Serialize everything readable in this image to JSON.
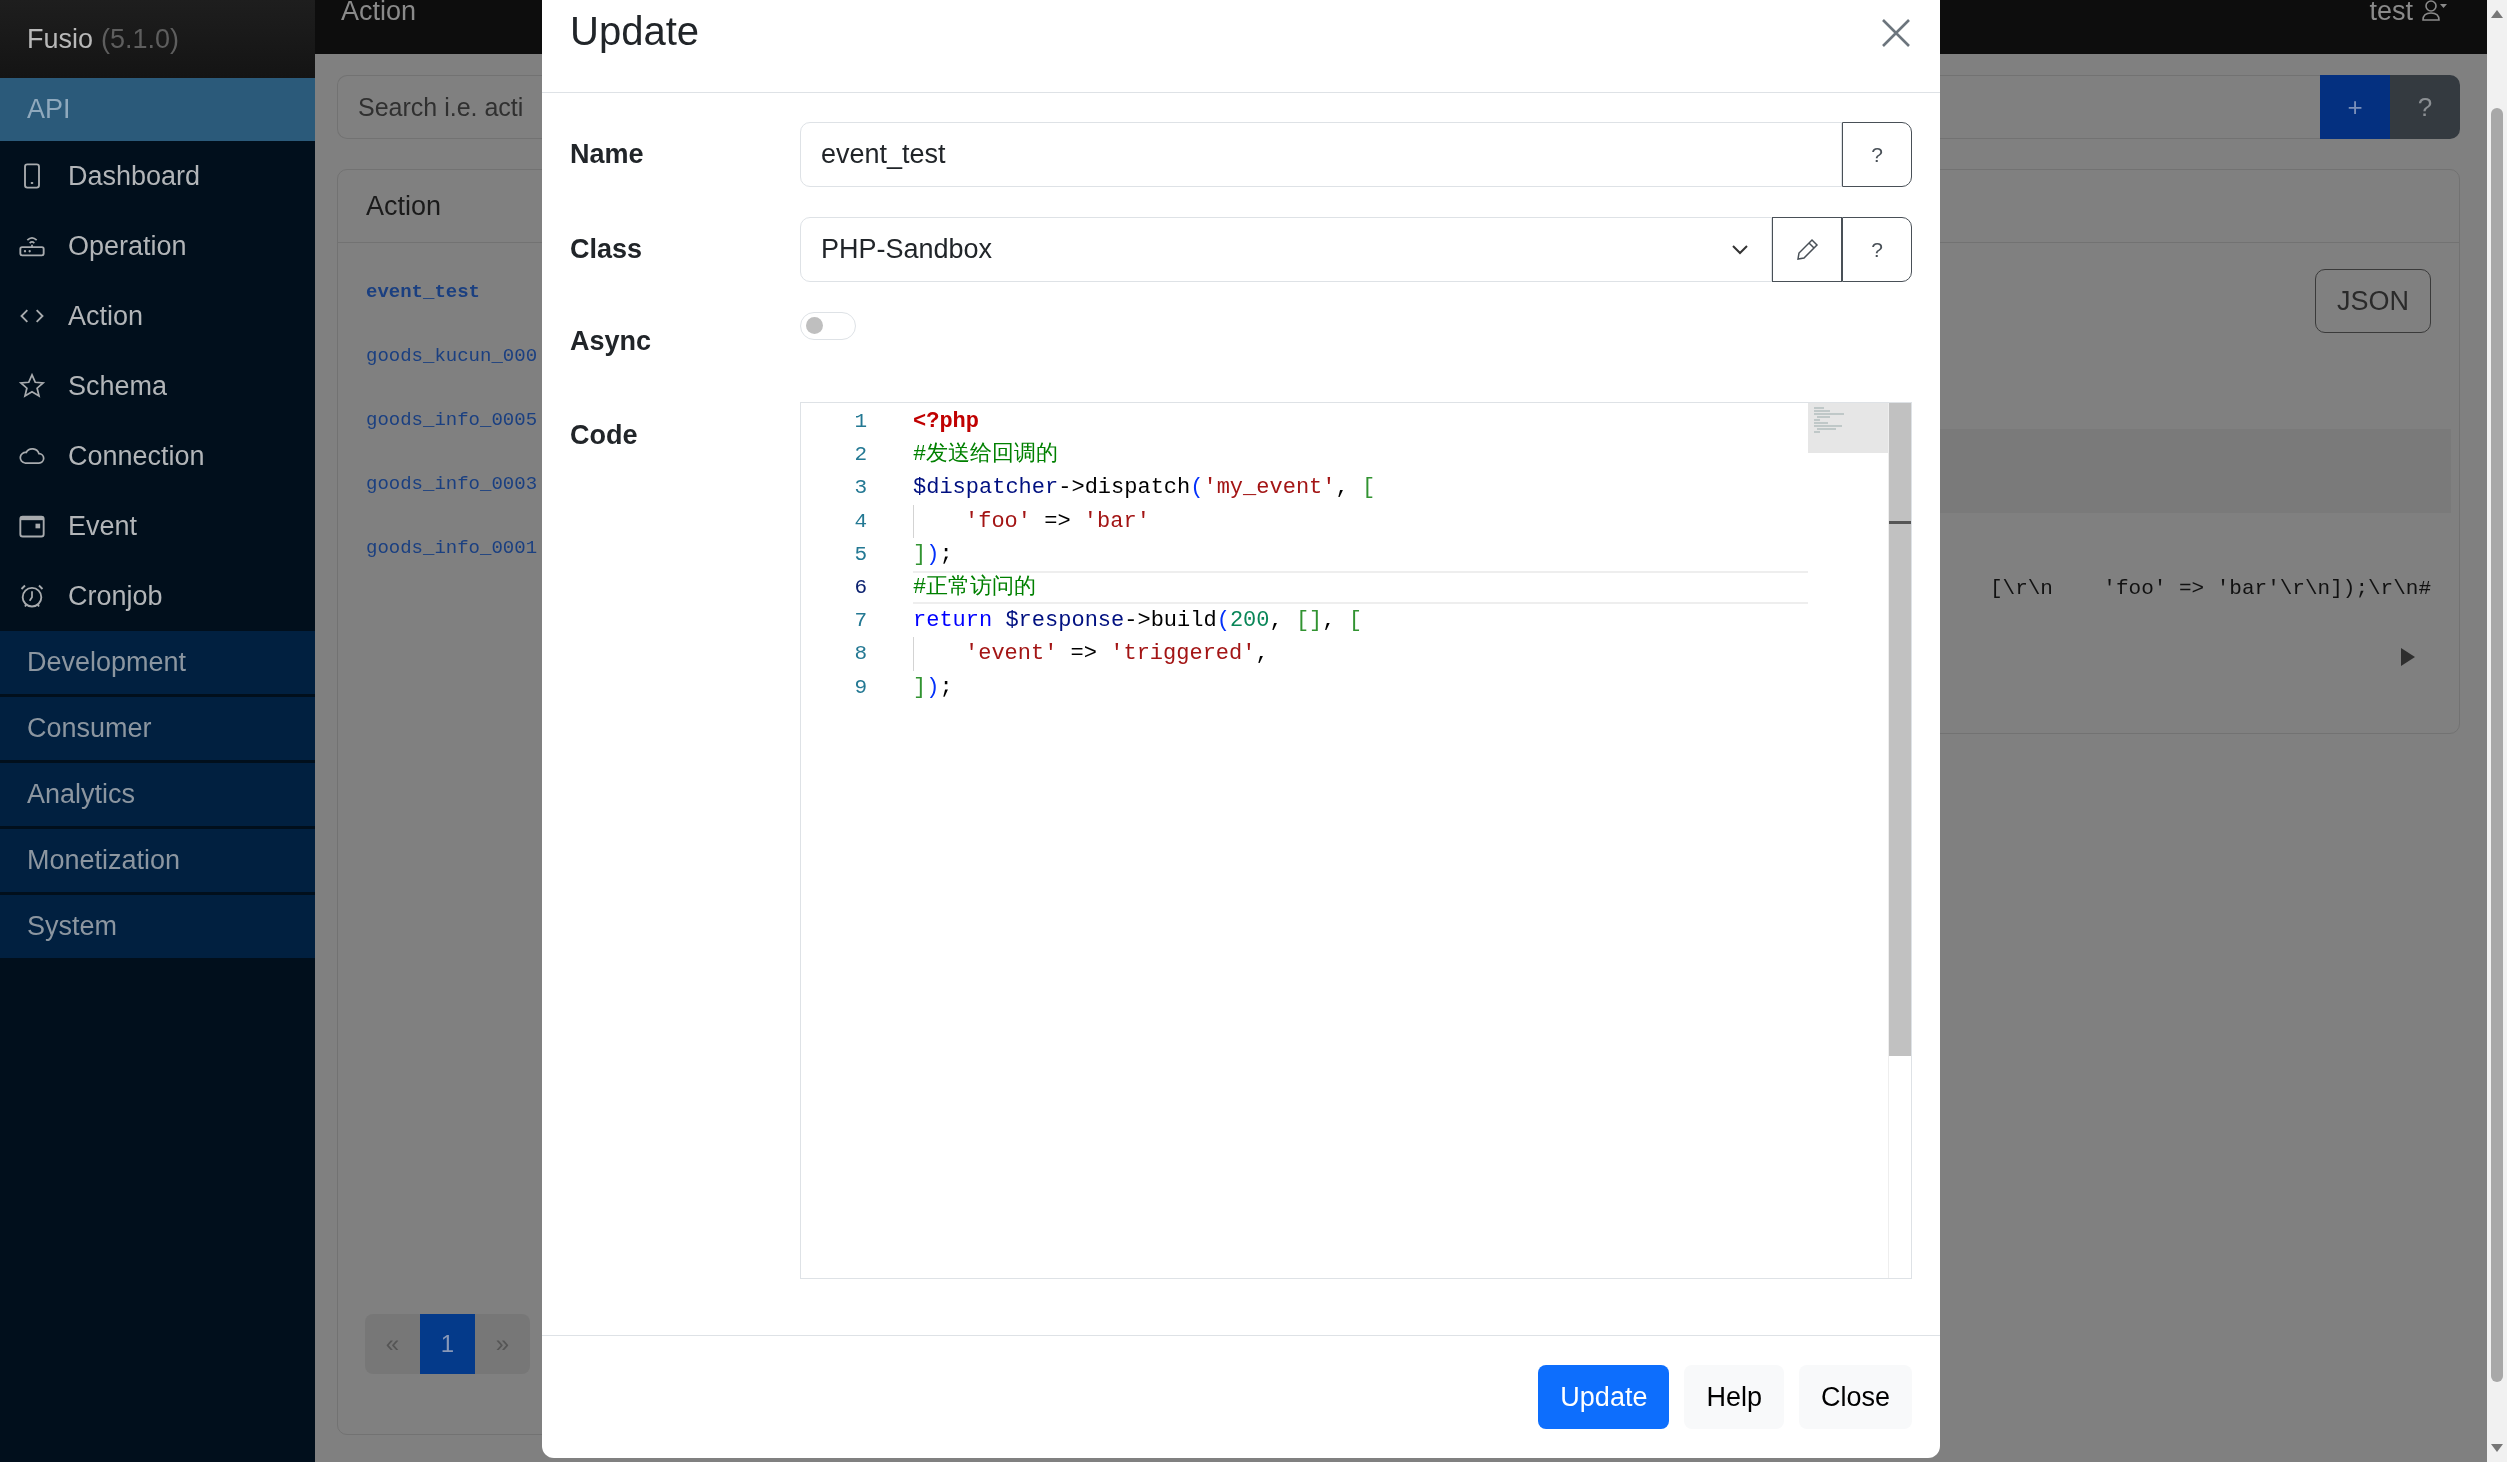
{
  "navbar": {
    "title": "Action",
    "user": "test"
  },
  "sidebar": {
    "brand": "Fusio",
    "version": "(5.1.0)",
    "groups": [
      {
        "label": "API",
        "expanded": true,
        "items": [
          {
            "label": "Dashboard"
          },
          {
            "label": "Operation"
          },
          {
            "label": "Action"
          },
          {
            "label": "Schema"
          },
          {
            "label": "Connection"
          },
          {
            "label": "Event"
          },
          {
            "label": "Cronjob"
          }
        ]
      },
      {
        "label": "Development",
        "expanded": false
      },
      {
        "label": "Consumer",
        "expanded": false
      },
      {
        "label": "Analytics",
        "expanded": false
      },
      {
        "label": "Monetization",
        "expanded": false
      },
      {
        "label": "System",
        "expanded": false
      }
    ]
  },
  "search": {
    "placeholder": "Search i.e. acti",
    "buttons": [
      "+",
      "?"
    ]
  },
  "list_card": {
    "title": "Action",
    "items": [
      {
        "label": "event_test",
        "selected": true
      },
      {
        "label": "goods_kucun_000",
        "selected": false
      },
      {
        "label": "goods_info_0005",
        "selected": false
      },
      {
        "label": "goods_info_0003",
        "selected": false
      },
      {
        "label": "goods_info_0001",
        "selected": false
      }
    ],
    "pagination": [
      {
        "label": "«",
        "selected": false
      },
      {
        "label": "1",
        "selected": true
      },
      {
        "label": "»",
        "selected": false
      }
    ]
  },
  "detail_card": {
    "button": "JSON",
    "code_preview": "[\\r\\n    'foo' => 'bar'\\r\\n]);\\r\\n#"
  },
  "modal": {
    "title": "Update",
    "name": {
      "label": "Name",
      "value": "event_test",
      "help": "?"
    },
    "class": {
      "label": "Class",
      "value": "PHP-Sandbox",
      "help": "?"
    },
    "async": {
      "label": "Async",
      "on": false
    },
    "code": {
      "label": "Code",
      "lines": [
        {
          "number": "1",
          "current": false,
          "tokens": [
            {
              "kind": "tag",
              "text": "<?php"
            }
          ]
        },
        {
          "number": "2",
          "current": false,
          "tokens": [
            {
              "kind": "comment",
              "text": "#发送给回调的"
            }
          ]
        },
        {
          "number": "3",
          "current": false,
          "tokens": [
            {
              "kind": "var",
              "text": "$dispatcher"
            },
            {
              "kind": "plain",
              "text": "->dispatch"
            },
            {
              "kind": "paren",
              "text": "("
            },
            {
              "kind": "string",
              "text": "'my_event'"
            },
            {
              "kind": "plain",
              "text": ", "
            },
            {
              "kind": "bracket",
              "text": "["
            }
          ]
        },
        {
          "number": "4",
          "current": false,
          "indent_guide": true,
          "tokens": [
            {
              "kind": "string",
              "text": "'foo'"
            },
            {
              "kind": "plain",
              "text": " => "
            },
            {
              "kind": "string",
              "text": "'bar'"
            }
          ]
        },
        {
          "number": "5",
          "current": false,
          "tokens": [
            {
              "kind": "bracket",
              "text": "]"
            },
            {
              "kind": "paren",
              "text": ")"
            },
            {
              "kind": "plain",
              "text": ";"
            }
          ]
        },
        {
          "number": "6",
          "current": true,
          "tokens": [
            {
              "kind": "comment",
              "text": "#正常访问的"
            }
          ]
        },
        {
          "number": "7",
          "current": false,
          "tokens": [
            {
              "kind": "keyword",
              "text": "return"
            },
            {
              "kind": "var",
              "text": " $response"
            },
            {
              "kind": "plain",
              "text": "->build"
            },
            {
              "kind": "paren",
              "text": "("
            },
            {
              "kind": "number",
              "text": "200"
            },
            {
              "kind": "plain",
              "text": ", "
            },
            {
              "kind": "bracket",
              "text": "[]"
            },
            {
              "kind": "plain",
              "text": ", "
            },
            {
              "kind": "bracket",
              "text": "["
            }
          ]
        },
        {
          "number": "8",
          "current": false,
          "indent_guide": true,
          "tokens": [
            {
              "kind": "string",
              "text": "'event'"
            },
            {
              "kind": "plain",
              "text": " => "
            },
            {
              "kind": "string",
              "text": "'triggered'"
            },
            {
              "kind": "plain",
              "text": ","
            }
          ]
        },
        {
          "number": "9",
          "current": false,
          "tokens": [
            {
              "kind": "bracket",
              "text": "]"
            },
            {
              "kind": "paren",
              "text": ")"
            },
            {
              "kind": "plain",
              "text": ";"
            }
          ]
        }
      ]
    },
    "buttons": [
      {
        "label": "Update",
        "kind": "primary"
      },
      {
        "label": "Help",
        "kind": "light"
      },
      {
        "label": "Close",
        "kind": "light"
      }
    ]
  }
}
